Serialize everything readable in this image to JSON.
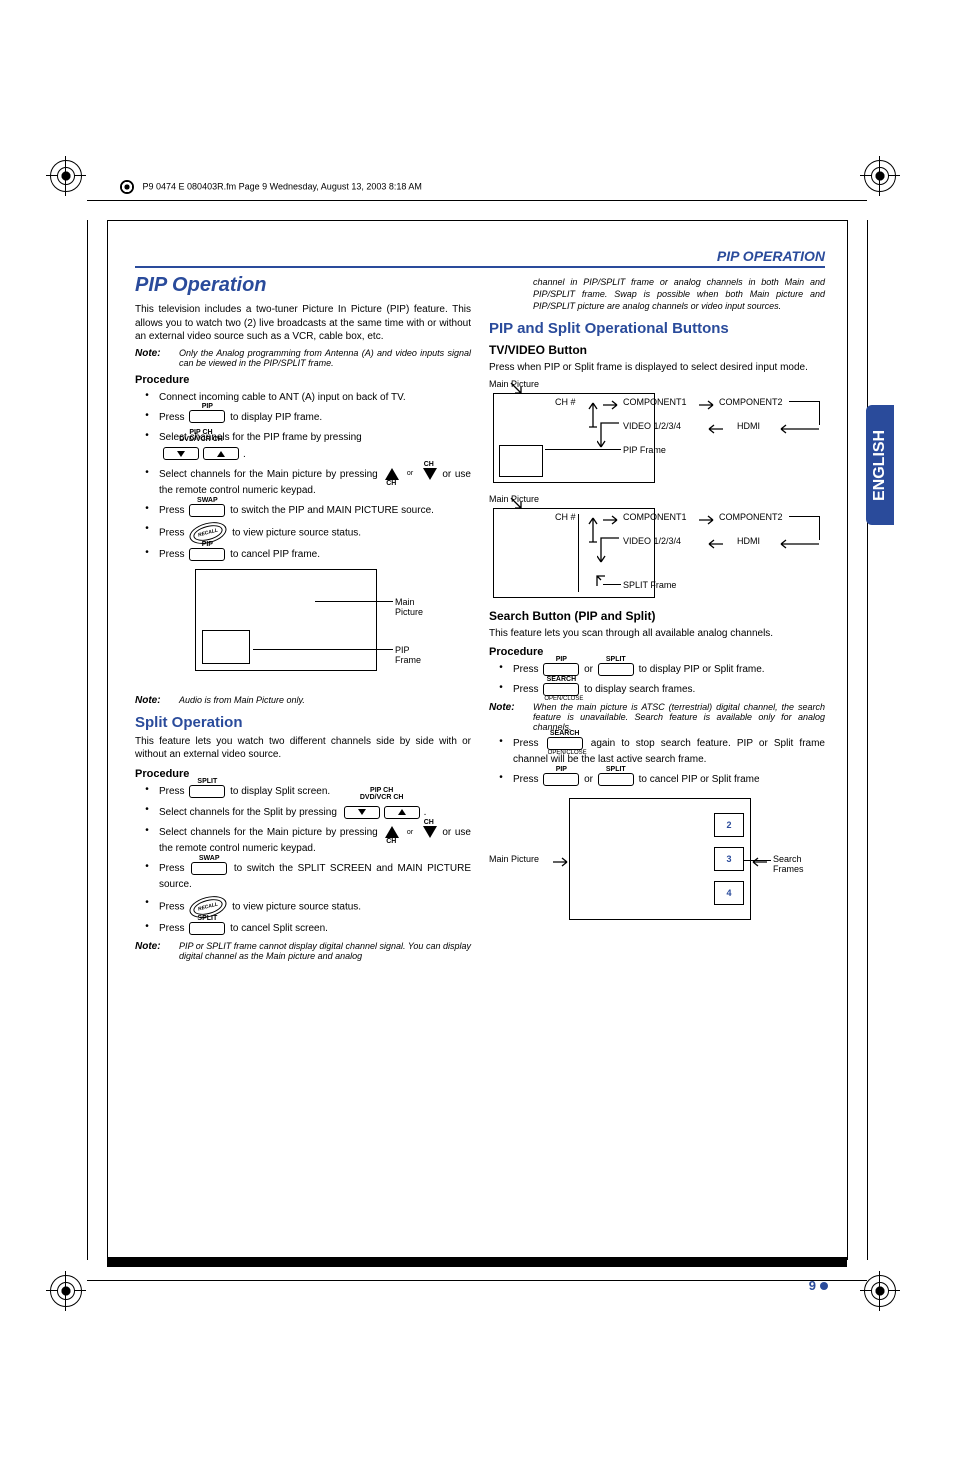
{
  "header_tag": "P9 0474 E  080403R.fm  Page 9  Wednesday, August 13, 2003  8:18 AM",
  "section_head": "PIP OPERATION",
  "english_tab": "ENGLISH",
  "page_number": "9",
  "col1": {
    "title": "PIP Operation",
    "intro": "This television includes a two-tuner Picture In Picture (PIP) feature. This allows you to watch two (2) live broadcasts at the same time with or without an external video source such as a VCR, cable box, etc.",
    "note1_label": "Note:",
    "note1_text": "Only the Analog programming from Antenna (A) and video inputs signal can be viewed in the PIP/SPLIT frame.",
    "proc1": "Procedure",
    "b1": "Connect incoming cable to ANT (A) input on back of TV.",
    "b2a": "Press ",
    "b2b": " to display PIP frame.",
    "b3a": "Select channels for the PIP frame by pressing",
    "b4a": "Select channels for the Main picture by pressing ",
    "b4b": " or use the remote control numeric keypad.",
    "b5a": "Press ",
    "b5b": " to switch the PIP and MAIN PICTURE source.",
    "b6a": "Press ",
    "b6b": " to view picture source status.",
    "b7a": "Press ",
    "b7b": " to cancel PIP frame.",
    "diagram_main": "Main Picture",
    "diagram_pip": "PIP Frame",
    "note2_label": "Note:",
    "note2_text": "Audio is from Main Picture only.",
    "split_title": "Split Operation",
    "split_intro": "This feature lets you watch two different channels side by side with or without an external video source.",
    "proc2": "Procedure",
    "s1a": "Press ",
    "s1b": " to display Split screen.",
    "s2a": "Select channels for the Split by pressing ",
    "s3a": "Select channels for the Main picture by pressing ",
    "s3b": " or use the remote control numeric keypad.",
    "s4a": "Press ",
    "s4b": " to switch the SPLIT SCREEN and MAIN PICTURE source.",
    "s5a": "Press ",
    "s5b": " to view picture source status.",
    "s6a": "Press ",
    "s6b": " to cancel Split screen.",
    "note3_label": "Note:",
    "note3_text": "PIP or SPLIT frame cannot display digital channel signal. You can display digital channel as the Main picture and analog",
    "btn_pip": "PIP",
    "btn_swap": "SWAP",
    "btn_split": "SPLIT",
    "btn_recall": "RECALL",
    "btn_pipch_top": "PIP CH",
    "btn_pipch_bot": "DVD/VCR CH",
    "btn_ch": "CH",
    "or": "or"
  },
  "col2": {
    "cont_note": "channel in PIP/SPLIT frame or analog channels in both Main and PIP/SPLIT frame. Swap is possible when both Main picture and PIP/SPLIT picture are analog channels or video input sources.",
    "h2": "PIP and Split Operational Buttons",
    "h3a": "TV/VIDEO Button",
    "p1": "Press when PIP or Split frame is displayed to select desired input mode.",
    "mp": "Main Picture",
    "ch": "CH #",
    "comp1": "COMPONENT1",
    "comp2": "COMPONENT2",
    "video": "VIDEO 1/2/3/4",
    "hdmi": "HDMI",
    "pipframe": "PIP Frame",
    "splitframe": "SPLIT Frame",
    "h3b": "Search Button (PIP and Split)",
    "p2": "This feature lets you scan through all available analog channels.",
    "proc": "Procedure",
    "r1a": "Press ",
    "r1b": " or ",
    "r1c": " to display PIP or Split frame.",
    "r2a": "Press ",
    "r2b": " to display search frames.",
    "note_label": "Note:",
    "note_text": "When the main picture is ATSC (terrestrial) digital channel, the search feature is unavailable. Search feature is available only for analog channels.",
    "r3a": "Press ",
    "r3b": " again to stop search feature. PIP or Split frame channel will be the last active search frame.",
    "r4a": "Press ",
    "r4b": " or ",
    "r4c": " to cancel PIP or Split frame",
    "btn_pip": "PIP",
    "btn_split": "SPLIT",
    "btn_search": "SEARCH",
    "btn_search_sub": "OPEN/CLOSE",
    "sf_label": "Search Frames",
    "sf2": "2",
    "sf3": "3",
    "sf4": "4"
  }
}
